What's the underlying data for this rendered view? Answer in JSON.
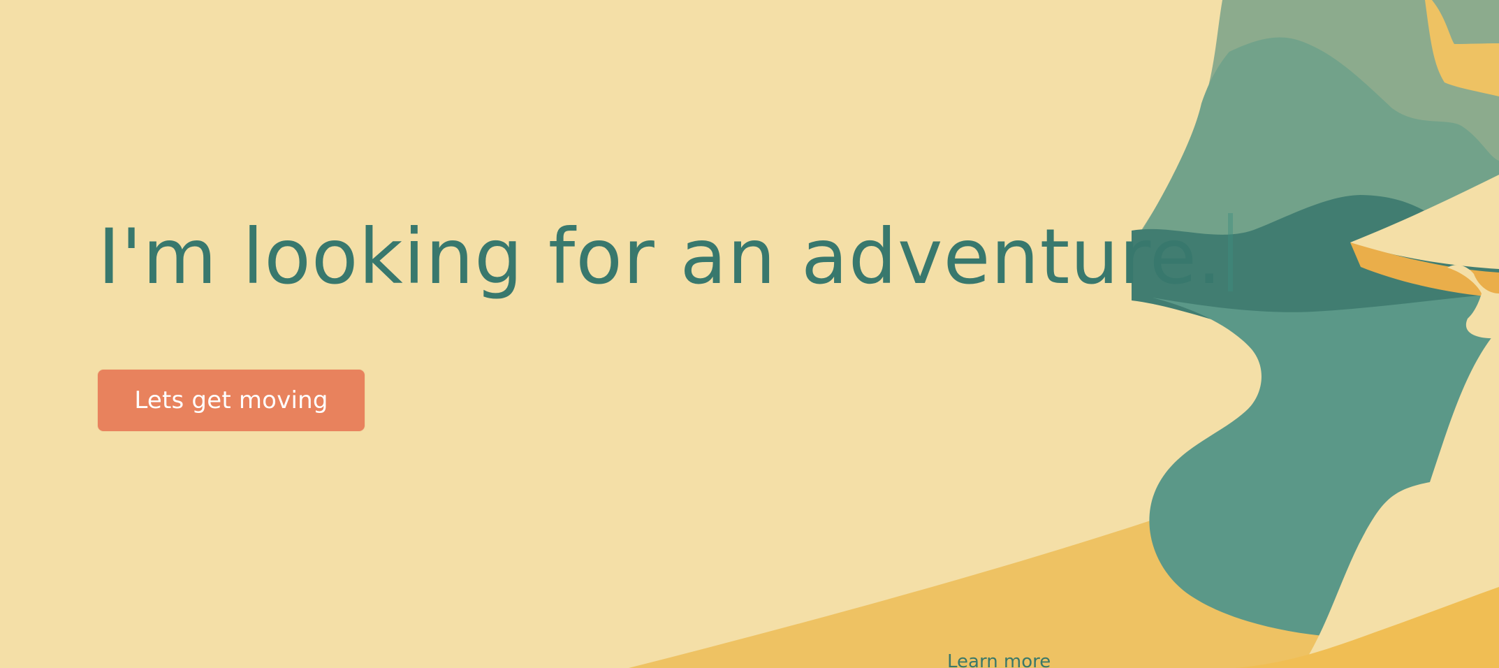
{
  "hero": {
    "headline": "I'm looking for an adventure.",
    "primary_button_label": "Lets get moving",
    "secondary_link_label": "Learn more"
  },
  "theme": {
    "background": "#f4dfa7",
    "headline_color": "#38786d",
    "button_background": "#e8825d",
    "button_text": "#ffffff",
    "illustration_dark_green": "#3f7b70",
    "illustration_green": "#5b9888",
    "illustration_light_green": "#8cab8d",
    "illustration_gold": "#eec263"
  },
  "icons": {
    "text_cursor": "text-cursor-icon",
    "illustration": "adventure-illustration"
  }
}
